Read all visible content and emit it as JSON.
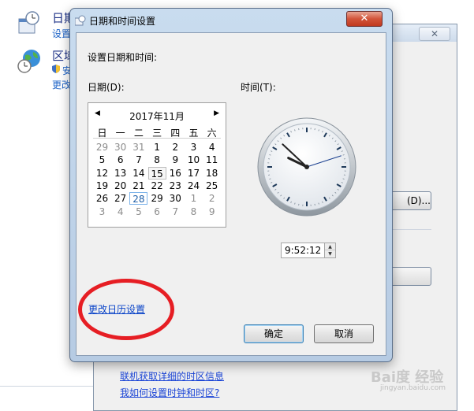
{
  "background": {
    "items": [
      {
        "title": "日期",
        "link": "设置"
      },
      {
        "title": "区域",
        "sub_link_1": "安",
        "sub_link_2": "更改"
      }
    ],
    "window": {
      "close_label": "✕",
      "button1_label": "(D)...",
      "link1": "联机获取详细的时区信息",
      "link2": "我如何设置时钟和时区?"
    },
    "watermark": "Bai度 经验",
    "watermark_sub": "jingyan.baidu.com"
  },
  "dialog": {
    "title": "日期和时间设置",
    "close_label": "✕",
    "heading": "设置日期和时间:",
    "date_label": "日期(D):",
    "time_label": "时间(T):",
    "calendar": {
      "month_label": "2017年11月",
      "prev": "◀",
      "next": "▶",
      "weekdays": [
        "日",
        "一",
        "二",
        "三",
        "四",
        "五",
        "六"
      ],
      "weeks": [
        [
          "29",
          "30",
          "31",
          "1",
          "2",
          "3",
          "4"
        ],
        [
          "5",
          "6",
          "7",
          "8",
          "9",
          "10",
          "11"
        ],
        [
          "12",
          "13",
          "14",
          "15",
          "16",
          "17",
          "18"
        ],
        [
          "19",
          "20",
          "21",
          "22",
          "23",
          "24",
          "25"
        ],
        [
          "26",
          "27",
          "28",
          "29",
          "30",
          "1",
          "2"
        ],
        [
          "3",
          "4",
          "5",
          "6",
          "7",
          "8",
          "9"
        ]
      ],
      "selected_day": "15",
      "today_day": "28"
    },
    "clock": {
      "hour": 9,
      "minute": 52,
      "second": 12
    },
    "time_value": "9:52:12",
    "change_calendar_link": "更改日历设置",
    "ok_label": "确定",
    "cancel_label": "取消",
    "highlight_color": "#e61e24"
  }
}
